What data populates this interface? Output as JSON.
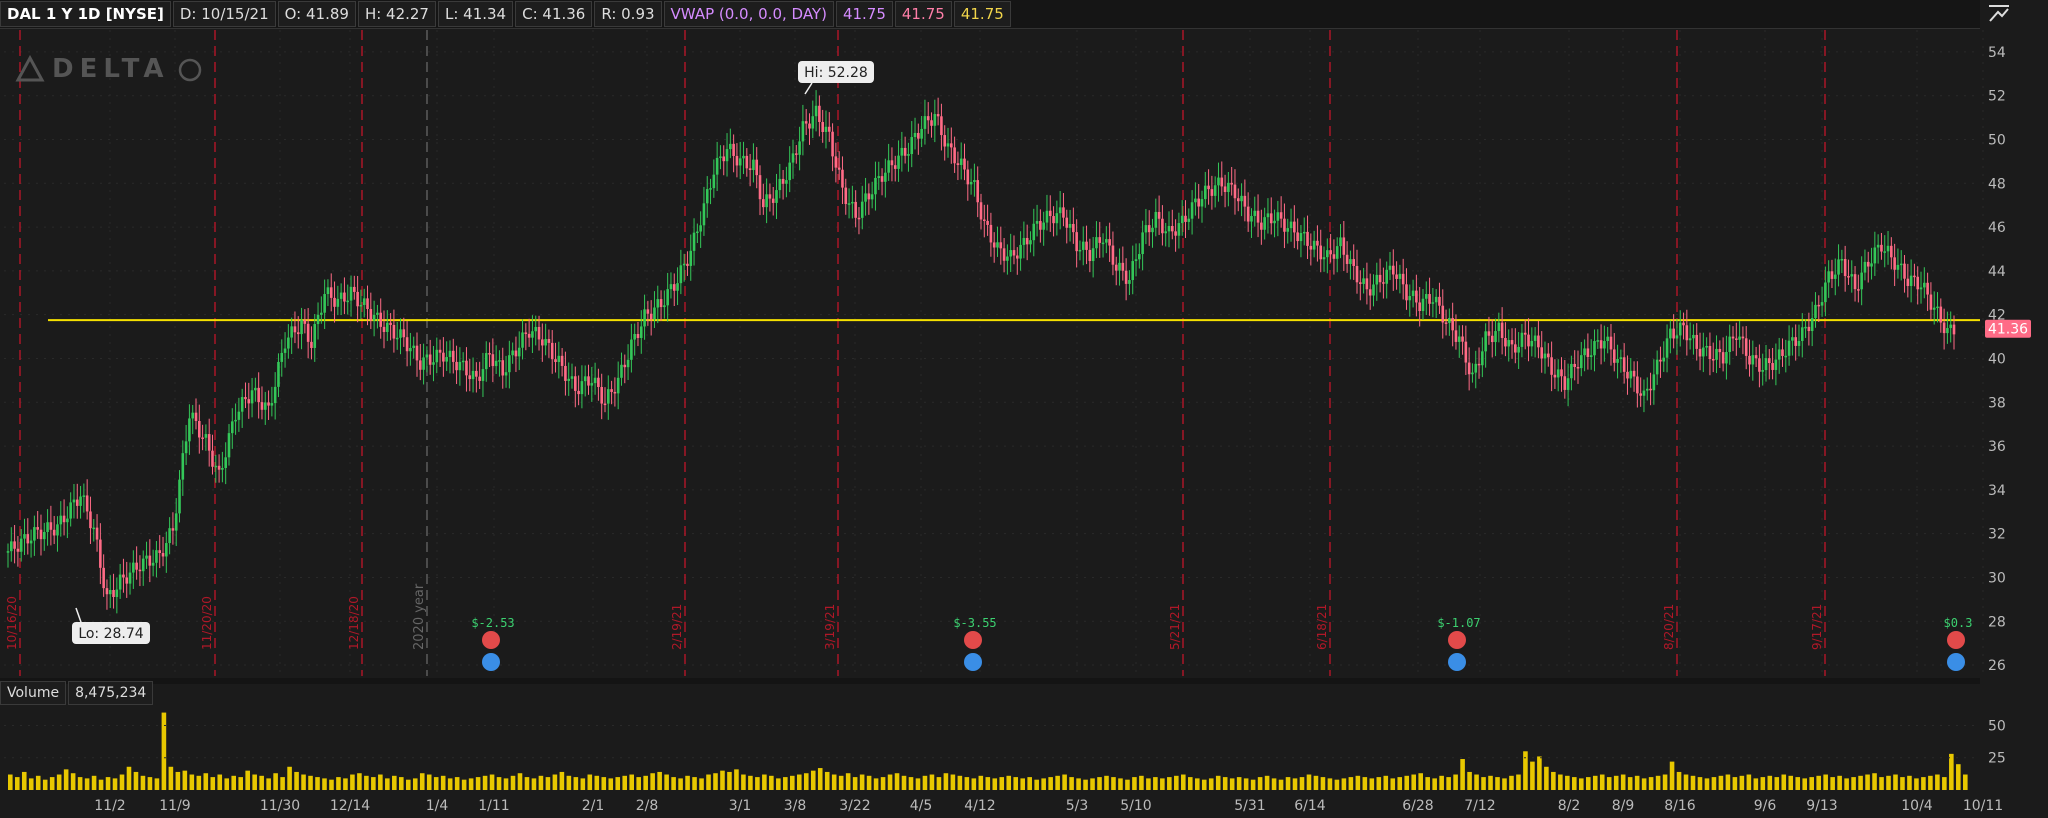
{
  "header": {
    "symbol": "DAL 1 Y 1D [NYSE]",
    "date": "D: 10/15/21",
    "open": "O: 41.89",
    "high": "H: 42.27",
    "low": "L: 41.34",
    "close": "C: 41.36",
    "range": "R: 0.93",
    "vwap_label": "VWAP (0.0, 0.0, DAY)",
    "vwap_v1": "41.75",
    "vwap_v2": "41.75",
    "vwap_v3": "41.75"
  },
  "volume_header": {
    "label": "Volume",
    "value": "8,475,234"
  },
  "logo": "DELTA",
  "colors": {
    "up": "#34c759",
    "down": "#ff6b86",
    "hline": "#f5e000",
    "volume": "#e8c800",
    "period": "#c0162a"
  },
  "chart_data": {
    "type": "candlestick",
    "price_axis": {
      "ticks": [
        26,
        28,
        30,
        32,
        34,
        36,
        38,
        40,
        42,
        44,
        46,
        48,
        50,
        52,
        54
      ],
      "range": [
        25.5,
        55
      ]
    },
    "volume_axis": {
      "ticks": [
        25,
        50
      ]
    },
    "x_tick_labels": [
      "11/2",
      "11/9",
      "11/30",
      "12/14",
      "1/4",
      "1/11",
      "2/1",
      "2/8",
      "3/1",
      "3/8",
      "3/22",
      "4/5",
      "4/12",
      "5/3",
      "5/10",
      "5/31",
      "6/14",
      "6/28",
      "7/12",
      "8/2",
      "8/9",
      "8/16",
      "9/6",
      "9/13",
      "10/4",
      "10/11"
    ],
    "period_labels": [
      "10/16/20",
      "11/20/20",
      "12/18/20",
      "2/19/21",
      "3/19/21",
      "5/21/21",
      "6/18/21",
      "8/20/21",
      "9/17/21"
    ],
    "year_label": "2020 year",
    "horizontal_line": 41.75,
    "last_price": "41.36",
    "high_label": "Hi: 52.28",
    "low_label": "Lo: 28.74",
    "earnings": [
      "$-2.53",
      "$-3.55",
      "$-1.07",
      "$0.3"
    ],
    "price_path": [
      [
        0,
        31.2
      ],
      [
        8,
        32.0
      ],
      [
        15,
        32.3
      ],
      [
        22,
        33.8
      ],
      [
        26,
        32.2
      ],
      [
        30,
        29.0
      ],
      [
        34,
        29.8
      ],
      [
        40,
        30.6
      ],
      [
        46,
        31.0
      ],
      [
        50,
        32.2
      ],
      [
        55,
        37.5
      ],
      [
        60,
        36.2
      ],
      [
        64,
        34.6
      ],
      [
        69,
        37.5
      ],
      [
        74,
        38.5
      ],
      [
        79,
        37.6
      ],
      [
        84,
        40.8
      ],
      [
        89,
        41.6
      ],
      [
        92,
        40.7
      ],
      [
        96,
        43.0
      ],
      [
        100,
        42.6
      ],
      [
        104,
        43.0
      ],
      [
        108,
        42.4
      ],
      [
        113,
        41.6
      ],
      [
        120,
        40.9
      ],
      [
        125,
        39.8
      ],
      [
        132,
        40.2
      ],
      [
        138,
        39.6
      ],
      [
        142,
        39.0
      ],
      [
        146,
        40.2
      ],
      [
        150,
        39.4
      ],
      [
        154,
        40.4
      ],
      [
        158,
        41.3
      ],
      [
        162,
        40.9
      ],
      [
        167,
        39.8
      ],
      [
        172,
        38.6
      ],
      [
        177,
        39.1
      ],
      [
        181,
        38.0
      ],
      [
        185,
        39.0
      ],
      [
        189,
        40.6
      ],
      [
        193,
        41.9
      ],
      [
        198,
        42.5
      ],
      [
        203,
        43.6
      ],
      [
        207,
        44.9
      ],
      [
        211,
        46.9
      ],
      [
        214,
        48.6
      ],
      [
        218,
        49.6
      ],
      [
        222,
        49.0
      ],
      [
        226,
        48.8
      ],
      [
        229,
        47.0
      ],
      [
        233,
        47.6
      ],
      [
        237,
        48.7
      ],
      [
        241,
        50.5
      ],
      [
        245,
        51.2
      ],
      [
        249,
        50.1
      ],
      [
        253,
        47.7
      ],
      [
        257,
        46.5
      ],
      [
        261,
        47.5
      ],
      [
        265,
        48.4
      ],
      [
        269,
        49.0
      ],
      [
        273,
        49.6
      ],
      [
        277,
        50.6
      ],
      [
        281,
        51.1
      ],
      [
        285,
        49.6
      ],
      [
        289,
        48.8
      ],
      [
        293,
        47.8
      ],
      [
        296,
        46.1
      ],
      [
        300,
        45.0
      ],
      [
        304,
        44.6
      ],
      [
        308,
        45.2
      ],
      [
        312,
        46.1
      ],
      [
        316,
        46.5
      ],
      [
        320,
        46.6
      ],
      [
        324,
        45.2
      ],
      [
        328,
        44.8
      ],
      [
        332,
        45.6
      ],
      [
        336,
        44.2
      ],
      [
        340,
        43.6
      ],
      [
        344,
        45.6
      ],
      [
        348,
        46.4
      ],
      [
        352,
        45.7
      ],
      [
        356,
        46.2
      ],
      [
        360,
        47.1
      ],
      [
        364,
        47.7
      ],
      [
        368,
        48.0
      ],
      [
        372,
        47.6
      ],
      [
        376,
        46.6
      ],
      [
        380,
        46.2
      ],
      [
        384,
        46.5
      ],
      [
        388,
        46.0
      ],
      [
        392,
        45.6
      ],
      [
        396,
        45.1
      ],
      [
        400,
        44.6
      ],
      [
        404,
        45.2
      ],
      [
        408,
        44.0
      ],
      [
        412,
        43.1
      ],
      [
        416,
        43.6
      ],
      [
        420,
        44.1
      ],
      [
        424,
        43.0
      ],
      [
        428,
        42.5
      ],
      [
        432,
        42.8
      ],
      [
        436,
        41.7
      ],
      [
        440,
        40.9
      ],
      [
        444,
        39.1
      ],
      [
        448,
        40.9
      ],
      [
        452,
        41.3
      ],
      [
        456,
        40.4
      ],
      [
        460,
        41.0
      ],
      [
        464,
        40.6
      ],
      [
        468,
        39.5
      ],
      [
        472,
        38.9
      ],
      [
        476,
        39.9
      ],
      [
        480,
        40.4
      ],
      [
        484,
        40.9
      ],
      [
        488,
        39.9
      ],
      [
        492,
        39.2
      ],
      [
        496,
        38.2
      ],
      [
        500,
        39.6
      ],
      [
        504,
        41.1
      ],
      [
        508,
        41.4
      ],
      [
        512,
        40.5
      ],
      [
        516,
        40.2
      ],
      [
        520,
        40.1
      ],
      [
        524,
        41.2
      ],
      [
        528,
        40.0
      ],
      [
        532,
        39.6
      ],
      [
        536,
        39.9
      ],
      [
        540,
        40.6
      ],
      [
        544,
        41.1
      ],
      [
        548,
        42.1
      ],
      [
        552,
        43.7
      ],
      [
        556,
        44.4
      ],
      [
        560,
        43.2
      ],
      [
        564,
        44.4
      ],
      [
        568,
        45.2
      ],
      [
        572,
        44.4
      ],
      [
        576,
        43.6
      ],
      [
        580,
        43.4
      ],
      [
        584,
        42.3
      ],
      [
        588,
        41.2
      ],
      [
        590,
        41.36
      ]
    ],
    "volume": [
      12,
      10,
      14,
      9,
      11,
      8,
      10,
      12,
      16,
      13,
      10,
      9,
      11,
      8,
      10,
      9,
      12,
      18,
      14,
      11,
      10,
      9,
      60,
      18,
      14,
      15,
      12,
      11,
      13,
      10,
      12,
      9,
      11,
      10,
      15,
      12,
      11,
      9,
      13,
      10,
      18,
      14,
      12,
      11,
      10,
      9,
      8,
      10,
      9,
      12,
      13,
      11,
      10,
      12,
      9,
      11,
      10,
      8,
      9,
      13,
      12,
      10,
      11,
      9,
      10,
      8,
      9,
      10,
      11,
      12,
      10,
      9,
      11,
      13,
      10,
      9,
      11,
      10,
      12,
      14,
      11,
      10,
      9,
      12,
      11,
      10,
      9,
      10,
      11,
      12,
      10,
      11,
      13,
      14,
      12,
      10,
      9,
      11,
      10,
      9,
      12,
      13,
      15,
      14,
      16,
      12,
      11,
      10,
      12,
      11,
      9,
      10,
      11,
      12,
      13,
      15,
      17,
      14,
      12,
      11,
      13,
      10,
      12,
      11,
      9,
      10,
      12,
      13,
      11,
      10,
      9,
      11,
      12,
      10,
      13,
      12,
      11,
      10,
      9,
      11,
      10,
      9,
      10,
      11,
      10,
      9,
      10,
      8,
      9,
      10,
      11,
      12,
      10,
      9,
      8,
      9,
      10,
      11,
      10,
      9,
      8,
      10,
      11,
      9,
      10,
      9,
      10,
      11,
      12,
      10,
      9,
      8,
      9,
      11,
      10,
      9,
      10,
      9,
      8,
      10,
      11,
      9,
      8,
      10,
      9,
      10,
      12,
      11,
      10,
      9,
      8,
      9,
      10,
      11,
      10,
      9,
      10,
      11,
      9,
      10,
      11,
      12,
      13,
      10,
      9,
      11,
      10,
      12,
      24,
      14,
      12,
      10,
      11,
      10,
      9,
      11,
      12,
      30,
      22,
      26,
      18,
      14,
      12,
      11,
      10,
      9,
      10,
      11,
      12,
      10,
      11,
      12,
      10,
      11,
      9,
      10,
      11,
      12,
      22,
      14,
      12,
      11,
      10,
      9,
      10,
      11,
      12,
      10,
      11,
      12,
      9,
      10,
      11,
      10,
      12,
      11,
      10,
      9,
      10,
      11,
      12,
      10,
      11,
      9,
      10,
      11,
      12,
      13,
      10,
      11,
      12,
      10,
      11,
      9,
      10,
      11,
      12,
      10,
      28,
      20,
      12
    ]
  }
}
